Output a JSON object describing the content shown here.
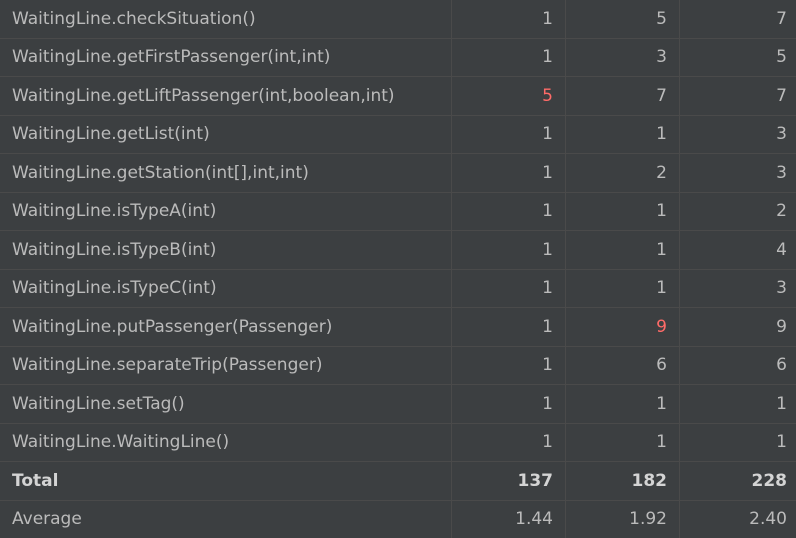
{
  "rows": [
    {
      "method": "WaitingLine.checkSituation()",
      "ev": "1",
      "iv": "5",
      "v": "7",
      "hl": []
    },
    {
      "method": "WaitingLine.getFirstPassenger(int,int)",
      "ev": "1",
      "iv": "3",
      "v": "5",
      "hl": []
    },
    {
      "method": "WaitingLine.getLiftPassenger(int,boolean,int)",
      "ev": "5",
      "iv": "7",
      "v": "7",
      "hl": [
        "ev"
      ]
    },
    {
      "method": "WaitingLine.getList(int)",
      "ev": "1",
      "iv": "1",
      "v": "3",
      "hl": []
    },
    {
      "method": "WaitingLine.getStation(int[],int,int)",
      "ev": "1",
      "iv": "2",
      "v": "3",
      "hl": []
    },
    {
      "method": "WaitingLine.isTypeA(int)",
      "ev": "1",
      "iv": "1",
      "v": "2",
      "hl": []
    },
    {
      "method": "WaitingLine.isTypeB(int)",
      "ev": "1",
      "iv": "1",
      "v": "4",
      "hl": []
    },
    {
      "method": "WaitingLine.isTypeC(int)",
      "ev": "1",
      "iv": "1",
      "v": "3",
      "hl": []
    },
    {
      "method": "WaitingLine.putPassenger(Passenger)",
      "ev": "1",
      "iv": "9",
      "v": "9",
      "hl": [
        "iv"
      ]
    },
    {
      "method": "WaitingLine.separateTrip(Passenger)",
      "ev": "1",
      "iv": "6",
      "v": "6",
      "hl": []
    },
    {
      "method": "WaitingLine.setTag()",
      "ev": "1",
      "iv": "1",
      "v": "1",
      "hl": []
    },
    {
      "method": "WaitingLine.WaitingLine()",
      "ev": "1",
      "iv": "1",
      "v": "1",
      "hl": []
    }
  ],
  "total": {
    "label": "Total",
    "ev": "137",
    "iv": "182",
    "v": "228"
  },
  "average": {
    "label": "Average",
    "ev": "1.44",
    "iv": "1.92",
    "v": "2.40"
  },
  "colors": {
    "highlight": "#ff6b68",
    "cell_bg": "#3c3f41",
    "grid_line": "#4a4a4a",
    "text": "#bbbbbb"
  }
}
